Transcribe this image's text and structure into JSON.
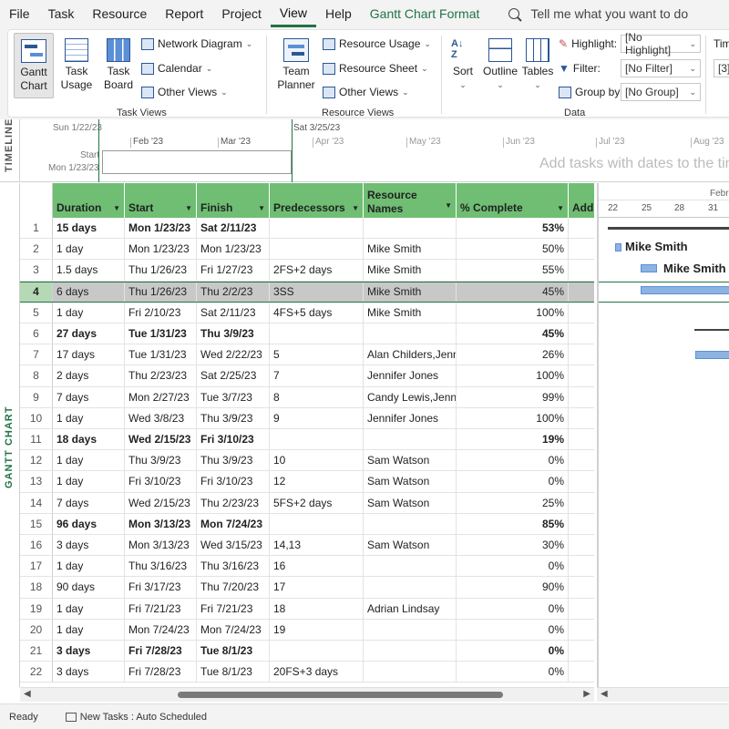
{
  "menu": {
    "tabs": [
      "File",
      "Task",
      "Resource",
      "Report",
      "Project",
      "View",
      "Help",
      "Gantt Chart Format"
    ],
    "active_tab": "View",
    "tell_me": "Tell me what you want to do"
  },
  "ribbon": {
    "task_views": {
      "gantt_chart": "Gantt Chart",
      "task_usage": "Task Usage",
      "task_board": "Task Board",
      "network_diagram": "Network Diagram",
      "calendar": "Calendar",
      "other_views": "Other Views",
      "group_label": "Task Views"
    },
    "resource_views": {
      "team_planner": "Team Planner",
      "resource_usage": "Resource Usage",
      "resource_sheet": "Resource Sheet",
      "other_views": "Other Views",
      "group_label": "Resource Views"
    },
    "data": {
      "sort": "Sort",
      "outline": "Outline",
      "tables": "Tables",
      "highlight_label": "Highlight:",
      "highlight_value": "[No Highlight]",
      "filter_label": "Filter:",
      "filter_value": "[No Filter]",
      "group_by_label": "Group by:",
      "group_by_value": "[No Group]",
      "group_label": "Data",
      "timescale_fragment": "Tim",
      "timescale_value": "[3]"
    }
  },
  "timeline": {
    "side_label": "TIMELINE",
    "start_date_top": "Sun 1/22/23",
    "start_label": "Start",
    "start_date": "Mon 1/23/23",
    "window_end": "Sat 3/25/23",
    "months": [
      "Feb '23",
      "Mar '23",
      "Apr '23",
      "May '23",
      "Jun '23",
      "Jul '23",
      "Aug '23"
    ],
    "add_tasks": "Add tasks with dates to the tim"
  },
  "grid": {
    "side_label": "GANTT CHART",
    "columns": [
      "Duration",
      "Start",
      "Finish",
      "Predecessors",
      "Resource Names",
      "% Complete",
      "Add"
    ],
    "rows": [
      {
        "id": "1",
        "duration": "15 days",
        "start": "Mon 1/23/23",
        "finish": "Sat 2/11/23",
        "pred": "",
        "res": "",
        "pct": "53%",
        "summary": true
      },
      {
        "id": "2",
        "duration": "1 day",
        "start": "Mon 1/23/23",
        "finish": "Mon 1/23/23",
        "pred": "",
        "res": "Mike Smith",
        "pct": "50%",
        "summary": false
      },
      {
        "id": "3",
        "duration": "1.5 days",
        "start": "Thu 1/26/23",
        "finish": "Fri 1/27/23",
        "pred": "2FS+2 days",
        "res": "Mike Smith",
        "pct": "55%",
        "summary": false
      },
      {
        "id": "4",
        "duration": "6 days",
        "start": "Thu 1/26/23",
        "finish": "Thu 2/2/23",
        "pred": "3SS",
        "res": "Mike Smith",
        "pct": "45%",
        "summary": false,
        "selected": true
      },
      {
        "id": "5",
        "duration": "1 day",
        "start": "Fri 2/10/23",
        "finish": "Sat 2/11/23",
        "pred": "4FS+5 days",
        "res": "Mike Smith",
        "pct": "100%",
        "summary": false
      },
      {
        "id": "6",
        "duration": "27 days",
        "start": "Tue 1/31/23",
        "finish": "Thu 3/9/23",
        "pred": "",
        "res": "",
        "pct": "45%",
        "summary": true
      },
      {
        "id": "7",
        "duration": "17 days",
        "start": "Tue 1/31/23",
        "finish": "Wed 2/22/23",
        "pred": "5",
        "res": "Alan Childers,Jenni",
        "pct": "26%",
        "summary": false
      },
      {
        "id": "8",
        "duration": "2 days",
        "start": "Thu 2/23/23",
        "finish": "Sat 2/25/23",
        "pred": "7",
        "res": "Jennifer Jones",
        "pct": "100%",
        "summary": false
      },
      {
        "id": "9",
        "duration": "7 days",
        "start": "Mon 2/27/23",
        "finish": "Tue 3/7/23",
        "pred": "8",
        "res": "Candy Lewis,Jennif",
        "pct": "99%",
        "summary": false
      },
      {
        "id": "10",
        "duration": "1 day",
        "start": "Wed 3/8/23",
        "finish": "Thu 3/9/23",
        "pred": "9",
        "res": "Jennifer Jones",
        "pct": "100%",
        "summary": false
      },
      {
        "id": "11",
        "duration": "18 days",
        "start": "Wed 2/15/23",
        "finish": "Fri 3/10/23",
        "pred": "",
        "res": "",
        "pct": "19%",
        "summary": true
      },
      {
        "id": "12",
        "duration": "1 day",
        "start": "Thu 3/9/23",
        "finish": "Thu 3/9/23",
        "pred": "10",
        "res": "Sam Watson",
        "pct": "0%",
        "summary": false
      },
      {
        "id": "13",
        "duration": "1 day",
        "start": "Fri 3/10/23",
        "finish": "Fri 3/10/23",
        "pred": "12",
        "res": "Sam Watson",
        "pct": "0%",
        "summary": false
      },
      {
        "id": "14",
        "duration": "7 days",
        "start": "Wed 2/15/23",
        "finish": "Thu 2/23/23",
        "pred": "5FS+2 days",
        "res": "Sam Watson",
        "pct": "25%",
        "summary": false
      },
      {
        "id": "15",
        "duration": "96 days",
        "start": "Mon 3/13/23",
        "finish": "Mon 7/24/23",
        "pred": "",
        "res": "",
        "pct": "85%",
        "summary": true
      },
      {
        "id": "16",
        "duration": "3 days",
        "start": "Mon 3/13/23",
        "finish": "Wed 3/15/23",
        "pred": "14,13",
        "res": "Sam Watson",
        "pct": "30%",
        "summary": false
      },
      {
        "id": "17",
        "duration": "1 day",
        "start": "Thu 3/16/23",
        "finish": "Thu 3/16/23",
        "pred": "16",
        "res": "",
        "pct": "0%",
        "summary": false
      },
      {
        "id": "18",
        "duration": "90 days",
        "start": "Fri 3/17/23",
        "finish": "Thu 7/20/23",
        "pred": "17",
        "res": "",
        "pct": "90%",
        "summary": false
      },
      {
        "id": "19",
        "duration": "1 day",
        "start": "Fri 7/21/23",
        "finish": "Fri 7/21/23",
        "pred": "18",
        "res": "Adrian Lindsay",
        "pct": "0%",
        "summary": false
      },
      {
        "id": "20",
        "duration": "1 day",
        "start": "Mon 7/24/23",
        "finish": "Mon 7/24/23",
        "pred": "19",
        "res": "",
        "pct": "0%",
        "summary": false
      },
      {
        "id": "21",
        "duration": "3 days",
        "start": "Fri 7/28/23",
        "finish": "Tue 8/1/23",
        "pred": "",
        "res": "",
        "pct": "0%",
        "summary": true
      },
      {
        "id": "22",
        "duration": "3 days",
        "start": "Fri 7/28/23",
        "finish": "Tue 8/1/23",
        "pred": "20FS+3 days",
        "res": "",
        "pct": "0%",
        "summary": false
      }
    ]
  },
  "chart": {
    "month": "Febr",
    "days": [
      "22",
      "25",
      "28",
      "31"
    ],
    "labels": [
      "Mike Smith",
      "Mike Smith"
    ]
  },
  "status": {
    "ready": "Ready",
    "new_tasks": "New Tasks : Auto Scheduled"
  }
}
